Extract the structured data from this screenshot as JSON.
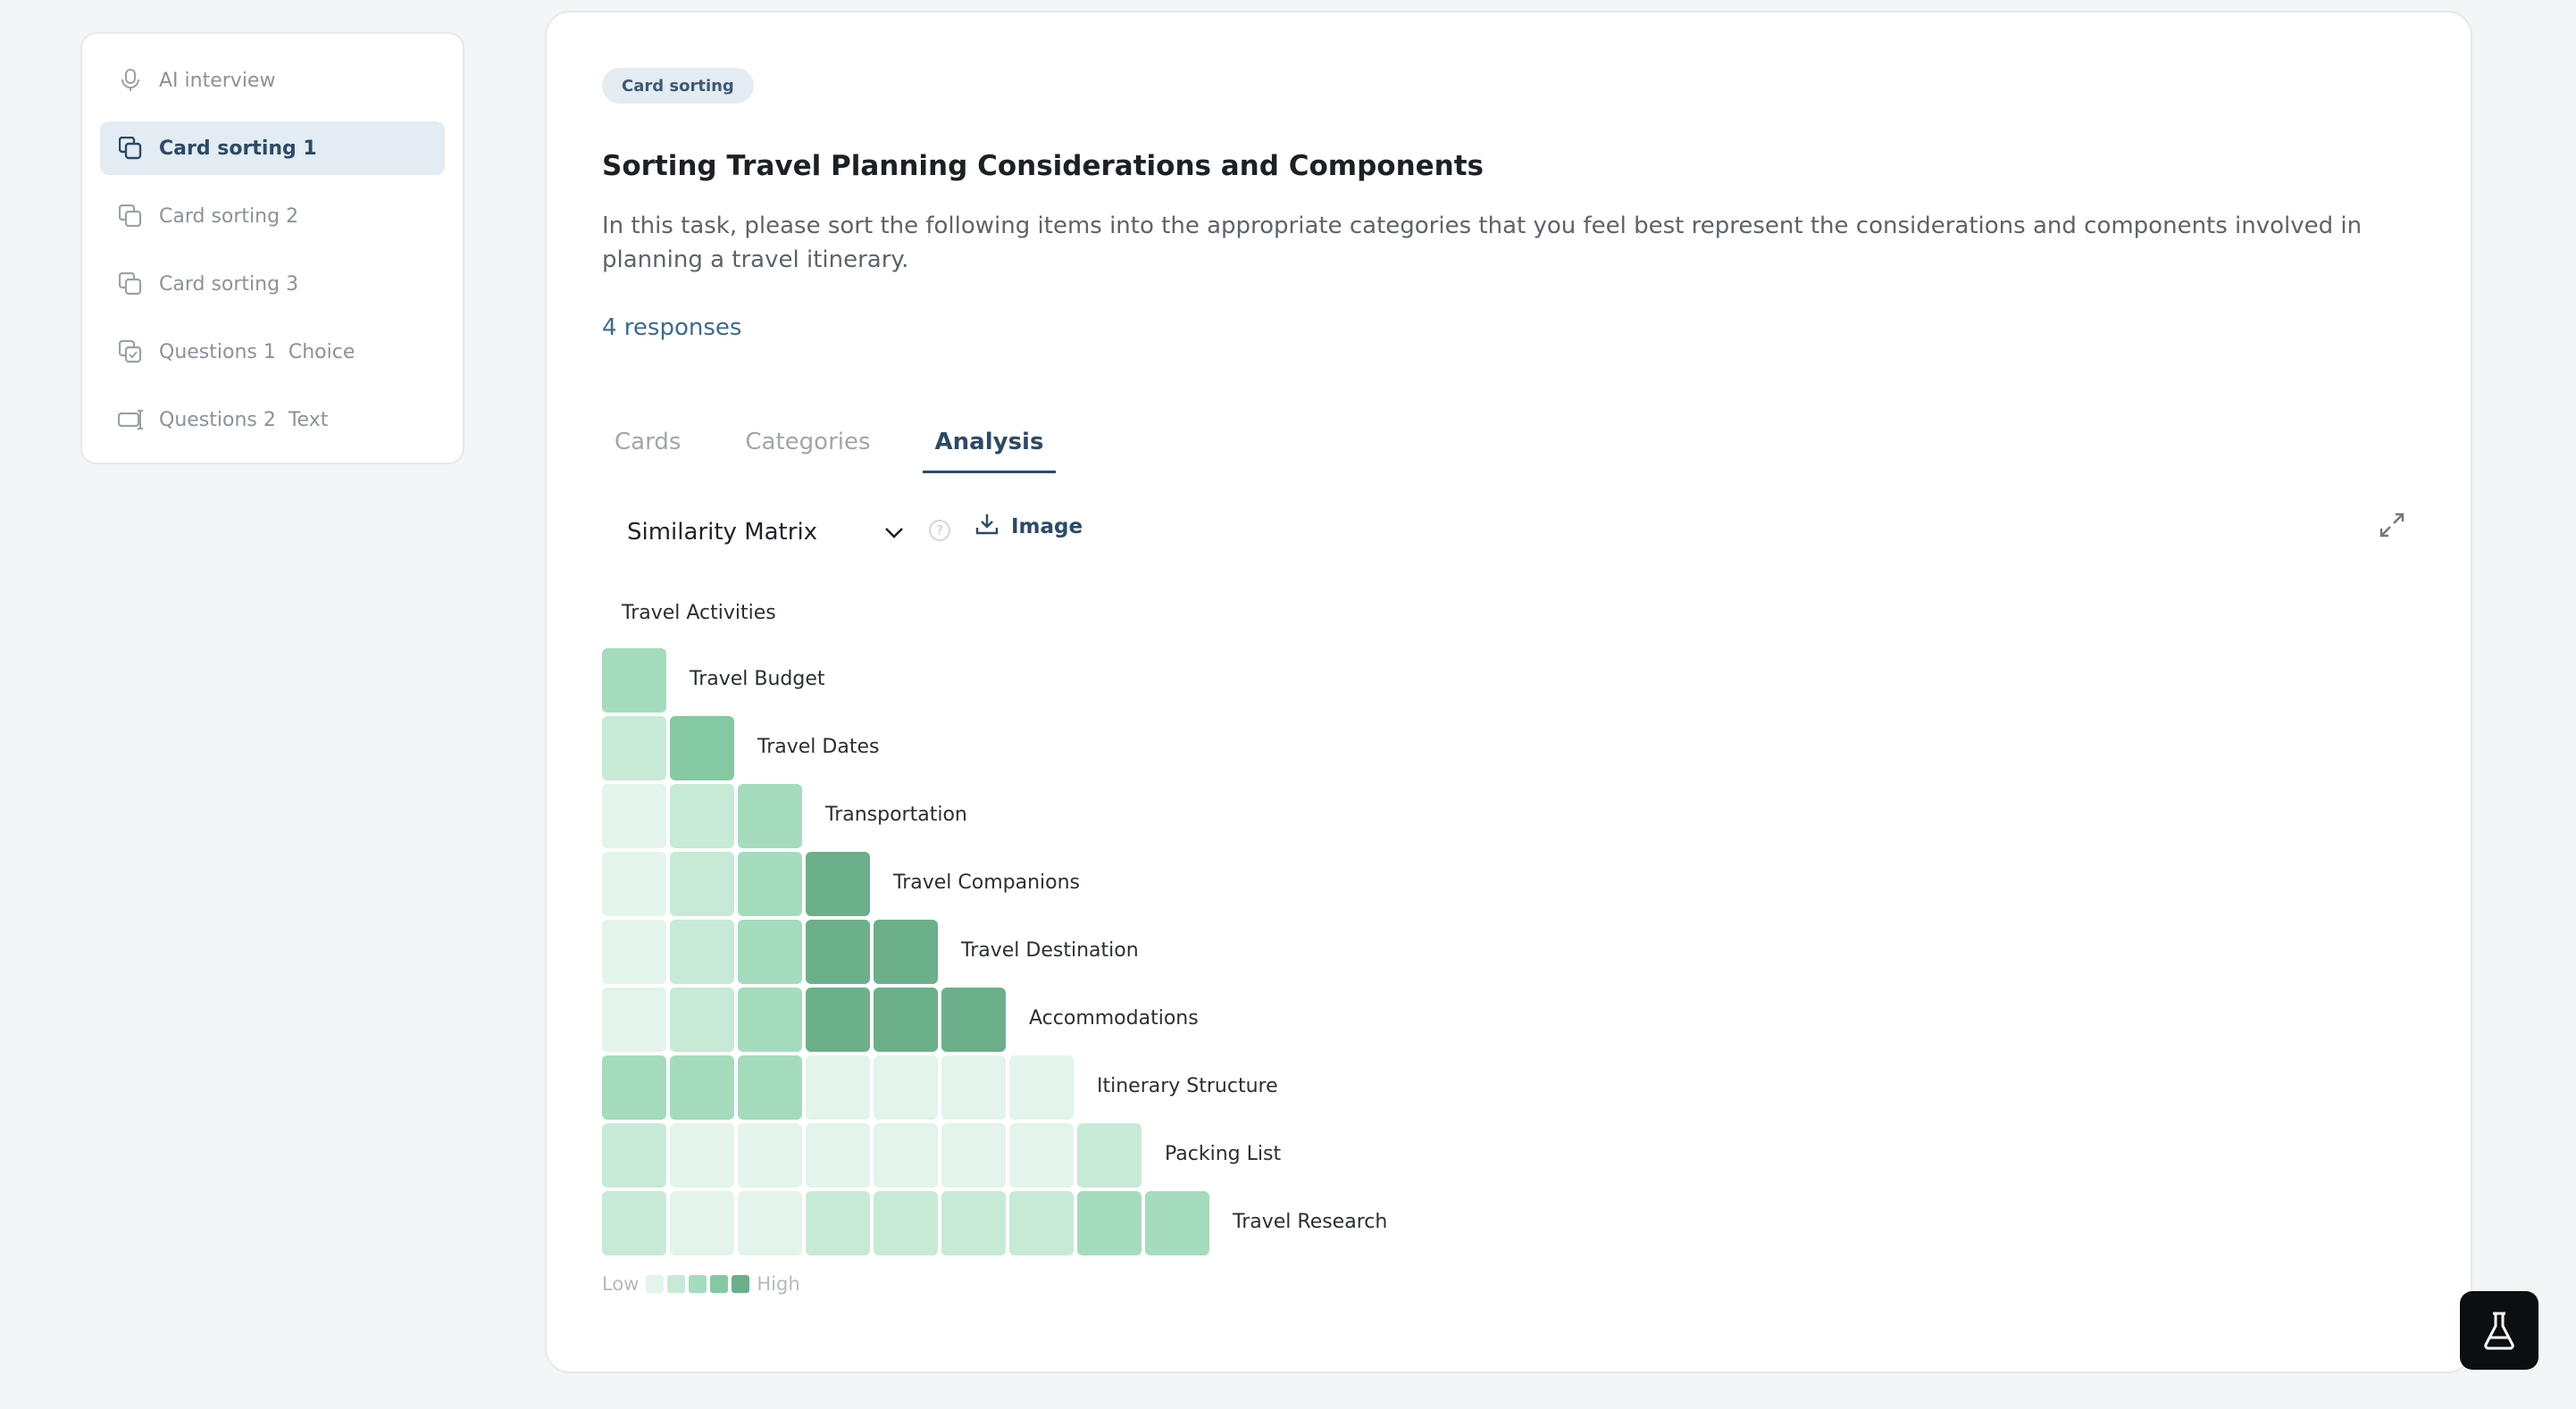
{
  "sidebar": {
    "items": [
      {
        "label": "AI interview",
        "sub": "",
        "icon": "microphone-icon",
        "active": false
      },
      {
        "label": "Card sorting 1",
        "sub": "",
        "icon": "cards-icon",
        "active": true
      },
      {
        "label": "Card sorting 2",
        "sub": "",
        "icon": "cards-icon",
        "active": false
      },
      {
        "label": "Card sorting 3",
        "sub": "",
        "icon": "cards-icon",
        "active": false
      },
      {
        "label": "Questions 1",
        "sub": "Choice",
        "icon": "choice-icon",
        "active": false
      },
      {
        "label": "Questions 2",
        "sub": "Text",
        "icon": "text-input-icon",
        "active": false
      }
    ]
  },
  "main": {
    "badge": "Card sorting",
    "title": "Sorting Travel Planning Considerations and Components",
    "description": "In this task, please sort the following items into the appropriate categories that you feel best represent the considerations and components involved in planning a travel itinerary.",
    "responses": "4 responses",
    "tabs": [
      "Cards",
      "Categories",
      "Analysis"
    ],
    "active_tab": "Analysis",
    "view_select": "Similarity Matrix",
    "image_button": "Image",
    "legend": {
      "low": "Low",
      "high": "High"
    }
  },
  "chart_data": {
    "type": "heatmap",
    "title": "",
    "items": [
      "Travel Activities",
      "Travel Budget",
      "Travel Dates",
      "Transportation",
      "Travel Companions",
      "Travel Destination",
      "Accommodations",
      "Itinerary Structure",
      "Packing List",
      "Travel Research"
    ],
    "scale": {
      "min": 0,
      "max": 4
    },
    "matrix": [
      [
        2
      ],
      [
        1,
        3
      ],
      [
        0,
        1,
        2
      ],
      [
        0,
        1,
        2,
        4
      ],
      [
        0,
        1,
        2,
        4,
        4
      ],
      [
        0,
        1,
        2,
        4,
        4,
        4
      ],
      [
        2,
        2,
        2,
        0,
        0,
        0,
        0
      ],
      [
        1,
        0,
        0,
        0,
        0,
        0,
        0,
        1
      ],
      [
        1,
        0,
        0,
        1,
        1,
        1,
        1,
        2,
        2
      ]
    ]
  },
  "colors": {
    "levels": [
      "#e3f4ea",
      "#c7ead6",
      "#a4dcbd",
      "#84c9a1",
      "#6bb08a"
    ],
    "accent": "#2c4a66"
  }
}
